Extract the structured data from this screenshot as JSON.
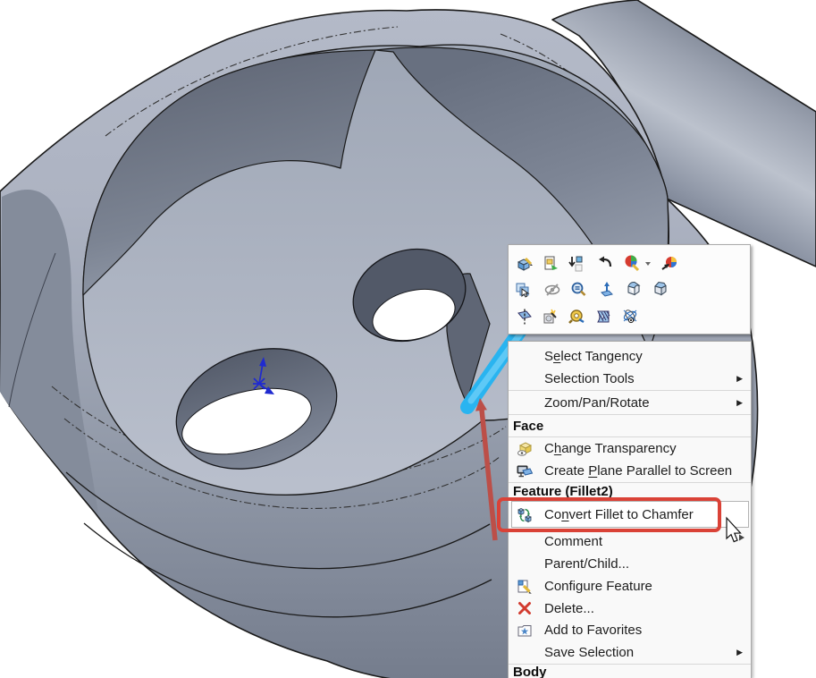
{
  "viewport": {
    "background_color": "#ffffff",
    "part": {
      "description": "gray shaded CAD part: rounded boss with twin counterbored pocket and cylindrical arm",
      "body_color": "#9fa6b5",
      "edge_color": "#1a1a1a",
      "selected_fillet_edge_color": "#29b4f0",
      "origin_triad_color": "#1f2ad0"
    }
  },
  "toolbar_popup": {
    "rows": [
      {
        "icons": [
          "edit-feature",
          "insert-into-new-part",
          "suppress",
          "undo",
          "edit-appearance",
          "appearance-dropdown-caret",
          "appearance-callout"
        ]
      },
      {
        "icons": [
          "select-other",
          "hide",
          "zoom-to-selection",
          "normal-to",
          "fillet-preview",
          "chamfer-preview"
        ]
      },
      {
        "icons": [
          "section-view",
          "isolate",
          "measure",
          "section-hatch",
          "view-orientation"
        ]
      }
    ]
  },
  "context_menu": {
    "submenu_arrow": "▶",
    "items": [
      {
        "type": "item",
        "label": "Select Tangency",
        "underline_index": 1
      },
      {
        "type": "item",
        "label": "Selection Tools",
        "submenu": true
      },
      {
        "type": "separator"
      },
      {
        "type": "item",
        "label": "Zoom/Pan/Rotate",
        "submenu": true
      },
      {
        "type": "separator"
      },
      {
        "type": "header",
        "label": "Face"
      },
      {
        "type": "separator"
      },
      {
        "type": "item",
        "label": "Change Transparency",
        "icon": "transparency-icon",
        "underline_index": 1
      },
      {
        "type": "item",
        "label": "Create Plane Parallel to Screen",
        "icon": "plane-parallel-icon",
        "underline_index": 7
      },
      {
        "type": "separator"
      },
      {
        "type": "header",
        "label": "Feature (Fillet2)"
      },
      {
        "type": "item",
        "label": "Convert Fillet to Chamfer",
        "icon": "convert-fillet-icon",
        "underline_index": 2,
        "highlighted": true
      },
      {
        "type": "item",
        "label": "Comment"
      },
      {
        "type": "item",
        "label": "Parent/Child..."
      },
      {
        "type": "item",
        "label": "Configure Feature",
        "icon": "configure-feature-icon"
      },
      {
        "type": "item",
        "label": "Delete...",
        "icon": "delete-icon"
      },
      {
        "type": "item",
        "label": "Add to Favorites",
        "icon": "favorites-icon"
      },
      {
        "type": "item",
        "label": "Save Selection",
        "submenu": true
      },
      {
        "type": "separator"
      },
      {
        "type": "header",
        "label": "Body"
      }
    ]
  },
  "annotations": {
    "highlight_box_color": "#da4237",
    "arrow_color": "#bc4f48",
    "highlighted_item": "Convert Fillet to Chamfer"
  },
  "cursor": "menu-pointer"
}
